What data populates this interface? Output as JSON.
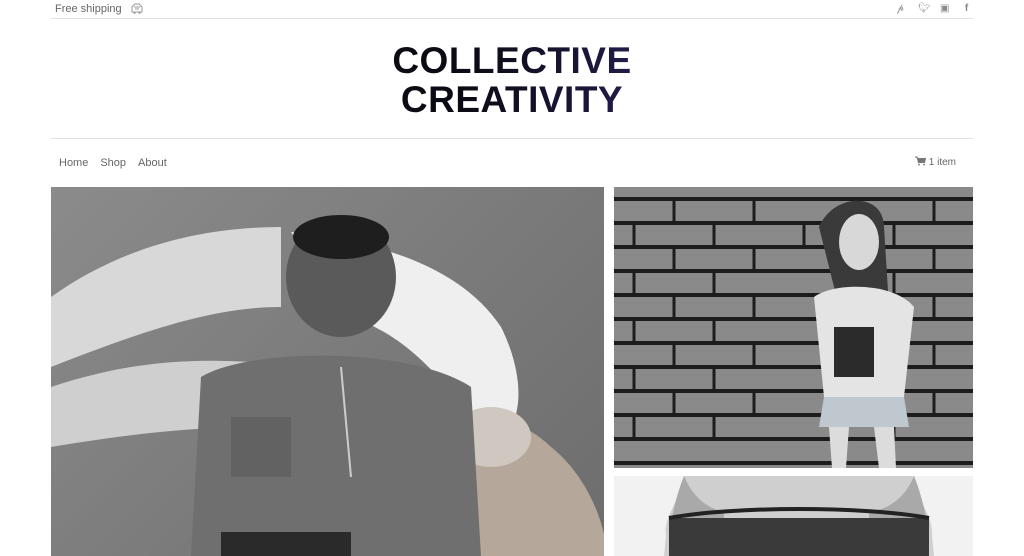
{
  "topbar": {
    "shipping_text": "Free shipping",
    "shipping_icon": "truck-icon",
    "social_icons": [
      "pinterest-icon",
      "twitter-icon",
      "instagram-icon",
      "facebook-icon"
    ]
  },
  "logo": {
    "line1": "COLLECTIVE",
    "line2": "CREATIVITY"
  },
  "nav": {
    "items": [
      {
        "label": "Home"
      },
      {
        "label": "Shop"
      },
      {
        "label": "About"
      }
    ],
    "cart_label": "1 item",
    "cart_icon": "cart-icon"
  },
  "gallery": {
    "photos": [
      {
        "name": "photo-couple"
      },
      {
        "name": "photo-girl-brick-wall"
      },
      {
        "name": "photo-bald-head"
      }
    ]
  }
}
